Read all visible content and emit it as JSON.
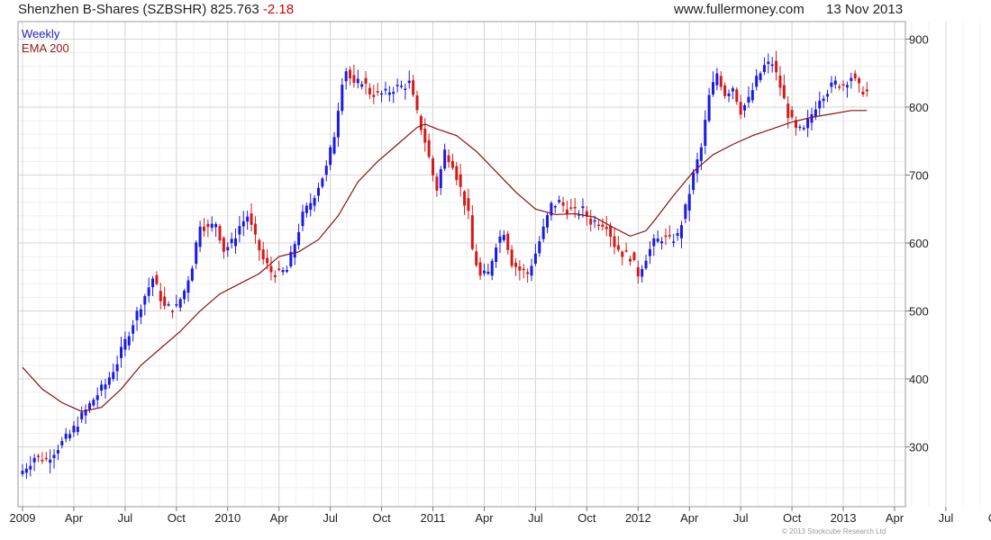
{
  "header": {
    "title": "Shenzhen B-Shares (SZBSHR)",
    "last": "825.763",
    "change": "-2.18",
    "site": "www.fullermoney.com",
    "date": "13 Nov 2013"
  },
  "footer": {
    "copyright": "© 2013 Stockcube Research Ltd"
  },
  "chart_data": {
    "type": "candlestick",
    "frequency": "Weekly",
    "x_tick_labels": [
      "2009",
      "Apr",
      "Jul",
      "Oct",
      "2010",
      "Apr",
      "Jul",
      "Oct",
      "2011",
      "Apr",
      "Jul",
      "Oct",
      "2012",
      "Apr",
      "Jul",
      "Oct",
      "2013",
      "Apr",
      "Jul",
      "Oct"
    ],
    "x_tick_weeks": [
      0,
      13,
      26,
      39,
      52,
      65,
      78,
      91,
      104,
      117,
      130,
      143,
      156,
      169,
      182,
      195,
      208,
      221,
      234,
      247
    ],
    "y_ticks": [
      300,
      400,
      500,
      600,
      700,
      800,
      900
    ],
    "ylim": [
      220,
      910
    ],
    "grid": true,
    "legend": {
      "position": "top-left",
      "entries": [
        "Weekly",
        "EMA 200"
      ]
    },
    "colors": {
      "up": "#1a1ae6",
      "down": "#d41a1a",
      "ema": "#8b1010",
      "grid": "#e3e3e3"
    },
    "series": [
      {
        "name": "Weekly",
        "close_points": [
          [
            0,
            265
          ],
          [
            3,
            285
          ],
          [
            6,
            282
          ],
          [
            9,
            300
          ],
          [
            12,
            318
          ],
          [
            15,
            345
          ],
          [
            18,
            370
          ],
          [
            21,
            392
          ],
          [
            24,
            425
          ],
          [
            27,
            470
          ],
          [
            30,
            510
          ],
          [
            33,
            548
          ],
          [
            36,
            505
          ],
          [
            39,
            505
          ],
          [
            41,
            530
          ],
          [
            43,
            568
          ],
          [
            45,
            630
          ],
          [
            47,
            620
          ],
          [
            49,
            630
          ],
          [
            51,
            590
          ],
          [
            53,
            600
          ],
          [
            55,
            625
          ],
          [
            57,
            640
          ],
          [
            59,
            605
          ],
          [
            61,
            575
          ],
          [
            63,
            558
          ],
          [
            65,
            555
          ],
          [
            67,
            560
          ],
          [
            69,
            600
          ],
          [
            71,
            640
          ],
          [
            73,
            660
          ],
          [
            75,
            685
          ],
          [
            77,
            710
          ],
          [
            79,
            760
          ],
          [
            81,
            840
          ],
          [
            82,
            855
          ],
          [
            84,
            830
          ],
          [
            86,
            840
          ],
          [
            88,
            822
          ],
          [
            90,
            818
          ],
          [
            92,
            820
          ],
          [
            94,
            828
          ],
          [
            96,
            830
          ],
          [
            98,
            835
          ],
          [
            100,
            790
          ],
          [
            102,
            750
          ],
          [
            104,
            700
          ],
          [
            105,
            680
          ],
          [
            107,
            735
          ],
          [
            109,
            718
          ],
          [
            111,
            680
          ],
          [
            113,
            640
          ],
          [
            114,
            590
          ],
          [
            116,
            550
          ],
          [
            118,
            555
          ],
          [
            120,
            600
          ],
          [
            122,
            618
          ],
          [
            124,
            572
          ],
          [
            126,
            560
          ],
          [
            128,
            555
          ],
          [
            130,
            585
          ],
          [
            132,
            620
          ],
          [
            134,
            655
          ],
          [
            136,
            660
          ],
          [
            138,
            650
          ],
          [
            140,
            645
          ],
          [
            142,
            648
          ],
          [
            144,
            632
          ],
          [
            146,
            632
          ],
          [
            148,
            628
          ],
          [
            150,
            598
          ],
          [
            152,
            585
          ],
          [
            154,
            580
          ],
          [
            156,
            555
          ],
          [
            158,
            580
          ],
          [
            160,
            600
          ],
          [
            162,
            608
          ],
          [
            164,
            604
          ],
          [
            166,
            610
          ],
          [
            168,
            650
          ],
          [
            170,
            700
          ],
          [
            172,
            740
          ],
          [
            174,
            815
          ],
          [
            176,
            850
          ],
          [
            178,
            820
          ],
          [
            180,
            830
          ],
          [
            182,
            795
          ],
          [
            184,
            810
          ],
          [
            186,
            840
          ],
          [
            188,
            860
          ],
          [
            190,
            865
          ],
          [
            192,
            830
          ],
          [
            194,
            790
          ],
          [
            196,
            765
          ],
          [
            198,
            765
          ],
          [
            200,
            790
          ],
          [
            202,
            815
          ],
          [
            204,
            825
          ],
          [
            206,
            835
          ],
          [
            208,
            835
          ],
          [
            210,
            845
          ],
          [
            212,
            828
          ],
          [
            214,
            822
          ]
        ]
      },
      {
        "name": "EMA 200",
        "points": [
          [
            0,
            417
          ],
          [
            5,
            385
          ],
          [
            10,
            365
          ],
          [
            15,
            352
          ],
          [
            20,
            358
          ],
          [
            25,
            385
          ],
          [
            30,
            420
          ],
          [
            35,
            445
          ],
          [
            40,
            470
          ],
          [
            45,
            500
          ],
          [
            50,
            525
          ],
          [
            55,
            540
          ],
          [
            60,
            555
          ],
          [
            65,
            580
          ],
          [
            70,
            587
          ],
          [
            75,
            605
          ],
          [
            80,
            640
          ],
          [
            85,
            690
          ],
          [
            90,
            720
          ],
          [
            95,
            745
          ],
          [
            100,
            770
          ],
          [
            102,
            775
          ],
          [
            105,
            768
          ],
          [
            110,
            758
          ],
          [
            115,
            735
          ],
          [
            120,
            705
          ],
          [
            125,
            675
          ],
          [
            130,
            650
          ],
          [
            135,
            642
          ],
          [
            140,
            643
          ],
          [
            145,
            638
          ],
          [
            150,
            622
          ],
          [
            154,
            610
          ],
          [
            158,
            618
          ],
          [
            160,
            632
          ],
          [
            165,
            670
          ],
          [
            170,
            705
          ],
          [
            175,
            730
          ],
          [
            180,
            745
          ],
          [
            185,
            758
          ],
          [
            190,
            768
          ],
          [
            195,
            778
          ],
          [
            200,
            785
          ],
          [
            205,
            790
          ],
          [
            210,
            795
          ],
          [
            214,
            795
          ]
        ]
      }
    ]
  }
}
